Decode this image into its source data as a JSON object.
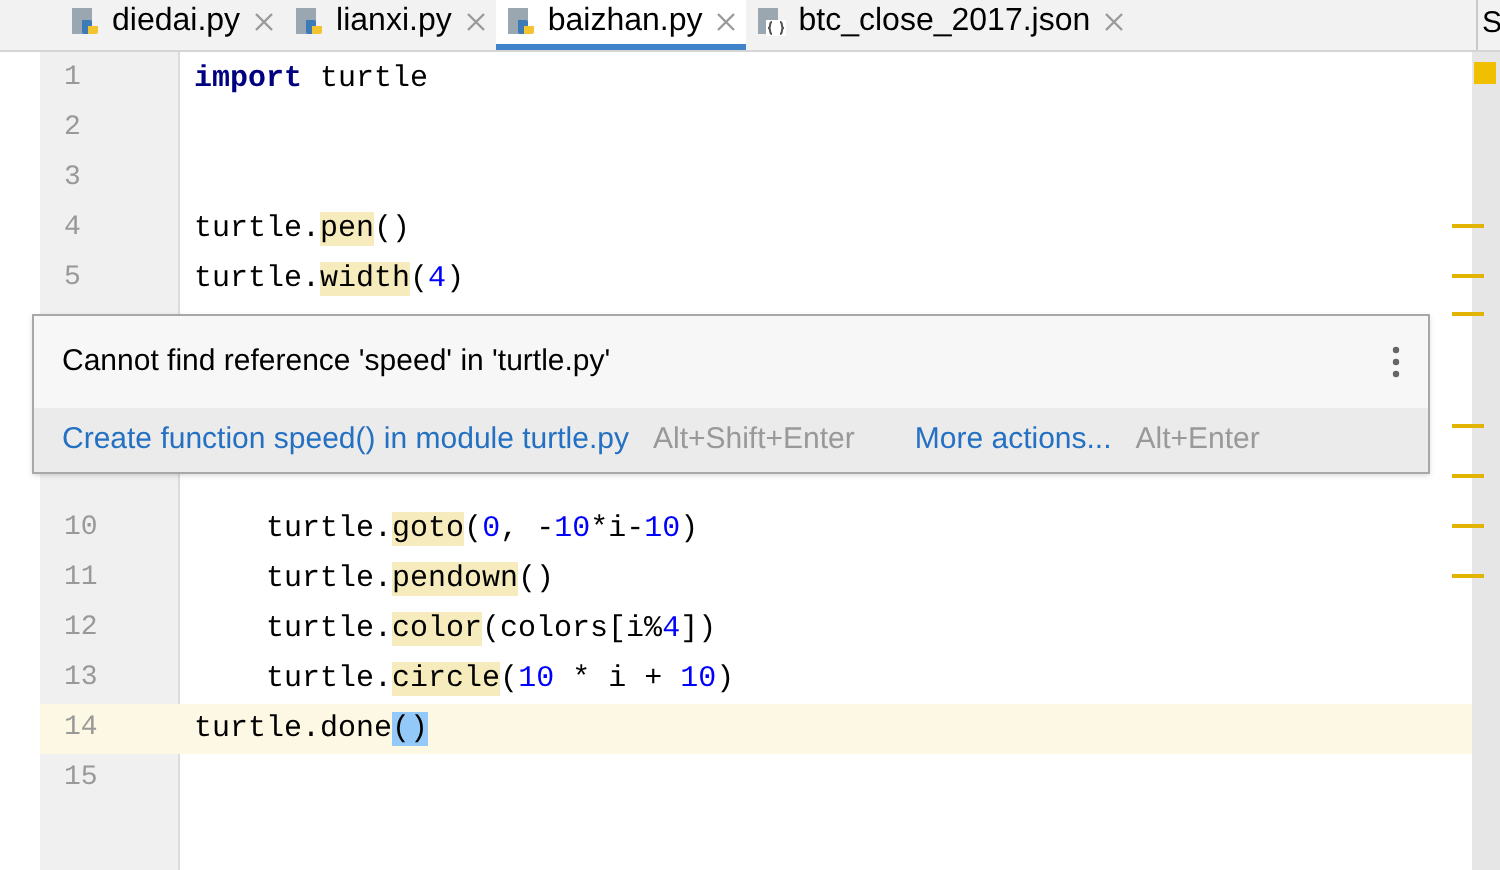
{
  "tabs": [
    {
      "label": "diedai.py",
      "kind": "python",
      "selected": false
    },
    {
      "label": "lianxi.py",
      "kind": "python",
      "selected": false
    },
    {
      "label": "baizhan.py",
      "kind": "python",
      "selected": true
    },
    {
      "label": "btc_close_2017.json",
      "kind": "json",
      "selected": false
    }
  ],
  "overflow_tab": "S",
  "code_lines": [
    {
      "number": "1",
      "current": false,
      "tokens": [
        {
          "text": "import",
          "kind": "keyword"
        },
        {
          "text": " turtle",
          "kind": "plain"
        }
      ]
    },
    {
      "number": "2",
      "current": false
    },
    {
      "number": "3",
      "current": false
    },
    {
      "number": "4",
      "current": false,
      "tokens": [
        {
          "text": "turtle.",
          "kind": "plain"
        },
        {
          "text": "pen",
          "kind": "unresolved"
        },
        {
          "text": "()",
          "kind": "plain"
        }
      ]
    },
    {
      "number": "5",
      "current": false,
      "tokens": [
        {
          "text": "turtle.",
          "kind": "plain"
        },
        {
          "text": "width",
          "kind": "unresolved"
        },
        {
          "text": "(",
          "kind": "plain"
        },
        {
          "text": "4",
          "kind": "number"
        },
        {
          "text": ")",
          "kind": "plain"
        }
      ]
    },
    {
      "kind": "gap"
    },
    {
      "number": "10",
      "current": false,
      "tokens": [
        {
          "text": "    turtle.",
          "kind": "plain"
        },
        {
          "text": "goto",
          "kind": "unresolved"
        },
        {
          "text": "(",
          "kind": "plain"
        },
        {
          "text": "0",
          "kind": "number"
        },
        {
          "text": ", -",
          "kind": "plain"
        },
        {
          "text": "10",
          "kind": "number"
        },
        {
          "text": "*i-",
          "kind": "plain"
        },
        {
          "text": "10",
          "kind": "number"
        },
        {
          "text": ")",
          "kind": "plain"
        }
      ]
    },
    {
      "number": "11",
      "current": false,
      "tokens": [
        {
          "text": "    turtle.",
          "kind": "plain"
        },
        {
          "text": "pendown",
          "kind": "unresolved"
        },
        {
          "text": "()",
          "kind": "plain"
        }
      ]
    },
    {
      "number": "12",
      "current": false,
      "tokens": [
        {
          "text": "    turtle.",
          "kind": "plain"
        },
        {
          "text": "color",
          "kind": "unresolved"
        },
        {
          "text": "(colors[i%",
          "kind": "plain"
        },
        {
          "text": "4",
          "kind": "number"
        },
        {
          "text": "])",
          "kind": "plain"
        }
      ]
    },
    {
      "number": "13",
      "current": false,
      "tokens": [
        {
          "text": "    turtle.",
          "kind": "plain"
        },
        {
          "text": "circle",
          "kind": "unresolved"
        },
        {
          "text": "(",
          "kind": "plain"
        },
        {
          "text": "10",
          "kind": "number"
        },
        {
          "text": " * i + ",
          "kind": "plain"
        },
        {
          "text": "10",
          "kind": "number"
        },
        {
          "text": ")",
          "kind": "plain"
        }
      ]
    },
    {
      "number": "14",
      "current": true,
      "tokens": [
        {
          "text": "turtle.done",
          "kind": "plain"
        },
        {
          "text": "()",
          "kind": "brace_match"
        }
      ]
    },
    {
      "number": "15",
      "current": false
    }
  ],
  "popup": {
    "message": "Cannot find reference 'speed' in 'turtle.py'",
    "actions": [
      {
        "label": "Create function speed() in module turtle.py",
        "shortcut": "Alt+Shift+Enter"
      },
      {
        "label": "More actions...",
        "shortcut": "Alt+Enter"
      }
    ]
  }
}
